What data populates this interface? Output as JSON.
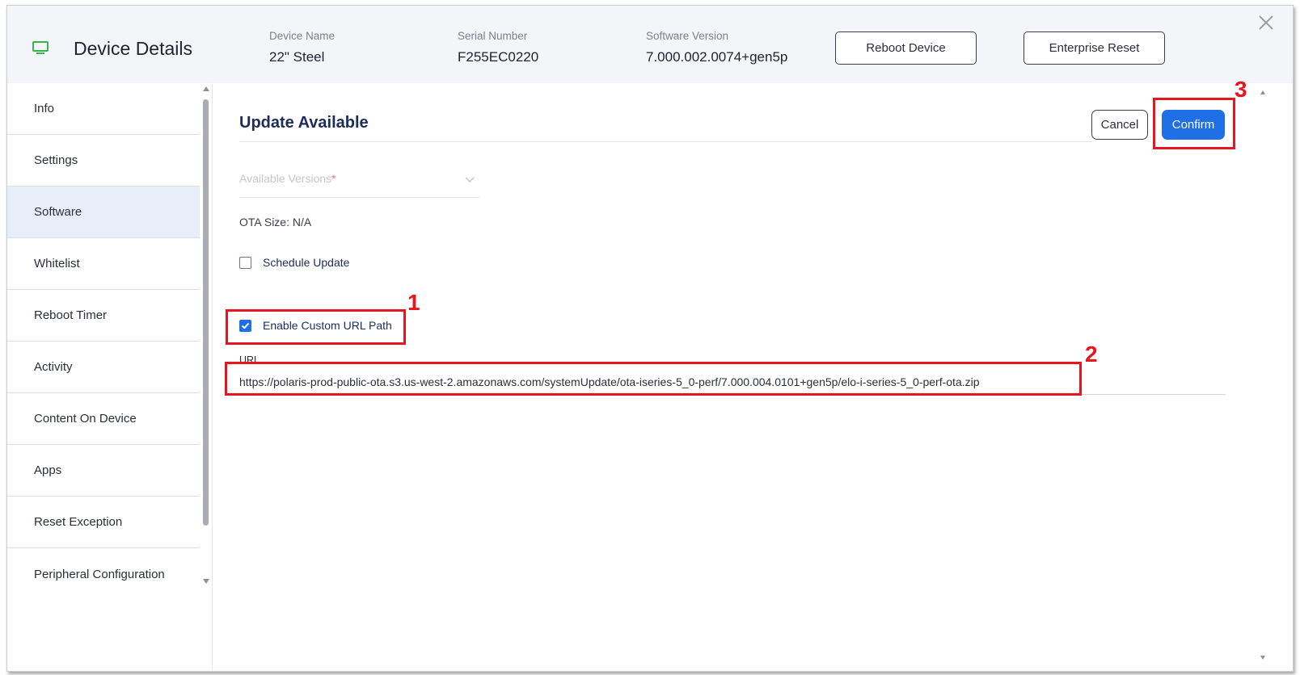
{
  "header": {
    "title": "Device Details",
    "device_name_label": "Device Name",
    "device_name": "22\" Steel",
    "serial_label": "Serial Number",
    "serial": "F255EC0220",
    "software_version_label": "Software Version",
    "software_version": "7.000.002.0074+gen5p",
    "reboot_label": "Reboot Device",
    "enterprise_reset_label": "Enterprise Reset"
  },
  "sidebar": {
    "items": [
      {
        "label": "Info"
      },
      {
        "label": "Settings"
      },
      {
        "label": "Software"
      },
      {
        "label": "Whitelist"
      },
      {
        "label": "Reboot Timer"
      },
      {
        "label": "Activity"
      },
      {
        "label": "Content On Device"
      },
      {
        "label": "Apps"
      },
      {
        "label": "Reset Exception"
      },
      {
        "label": "Peripheral Configuration"
      }
    ],
    "active": "Software"
  },
  "content": {
    "title": "Update Available",
    "cancel_label": "Cancel",
    "confirm_label": "Confirm",
    "versions_placeholder": "Available Versions",
    "versions_required": "*",
    "ota_size": "OTA Size: N/A",
    "schedule_label": "Schedule Update",
    "schedule_checked": false,
    "custom_url_label": "Enable Custom URL Path",
    "custom_url_checked": true,
    "url_label": "URL",
    "url_value": "https://polaris-prod-public-ota.s3.us-west-2.amazonaws.com/systemUpdate/ota-iseries-5_0-perf/7.000.004.0101+gen5p/elo-i-series-5_0-perf-ota.zip"
  },
  "annotations": {
    "one": "1",
    "two": "2",
    "three": "3"
  },
  "colors": {
    "accent": "#1f6fe6",
    "annotation": "#e8141e",
    "monitor_icon": "#35b84a",
    "active_nav": "#e7eefa"
  }
}
